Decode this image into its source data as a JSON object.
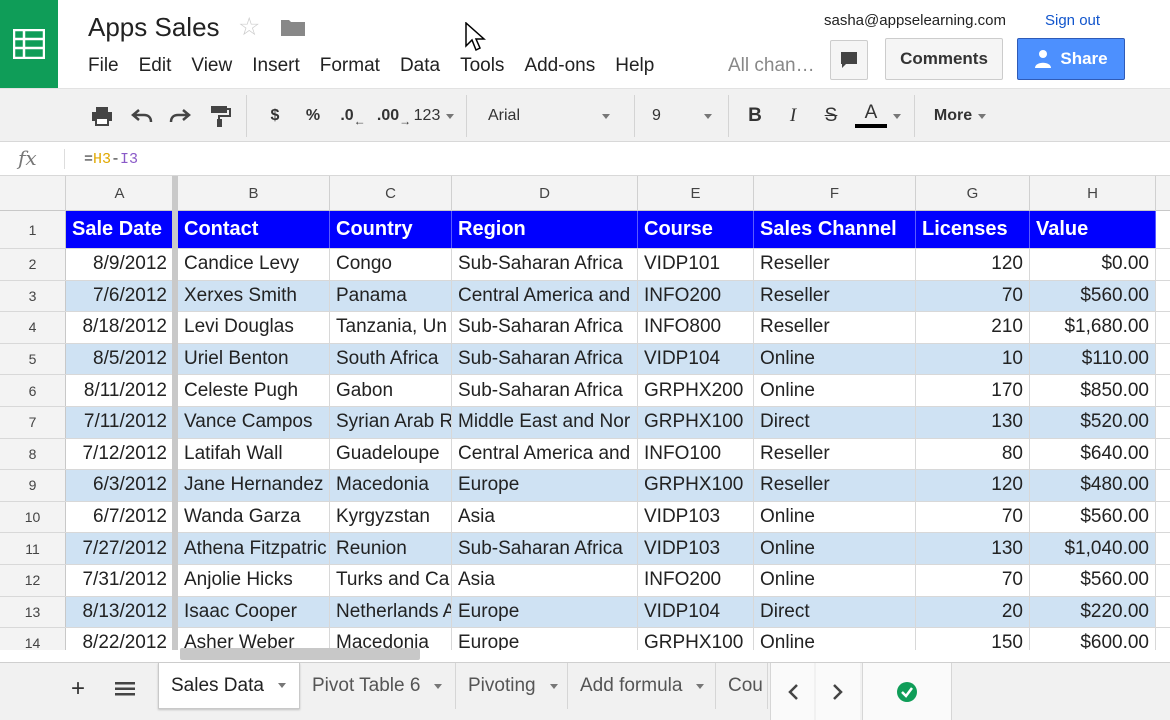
{
  "header": {
    "title": "Apps Sales",
    "star_icon": "star-icon",
    "folder_icon": "folder-icon",
    "user_email": "sasha@appselearning.com",
    "sign_out": "Sign out",
    "comments_label": "Comments",
    "share_label": "Share",
    "all_changes": "All chan…",
    "accent_color": "#0f9d58",
    "share_color": "#4d90fe"
  },
  "menu": [
    "File",
    "Edit",
    "View",
    "Insert",
    "Format",
    "Data",
    "Tools",
    "Add-ons",
    "Help"
  ],
  "toolbar": {
    "currency": "$",
    "percent": "%",
    "decrease_decimals": ".0",
    "increase_decimals": ".00",
    "more_formats": "123",
    "font": "Arial",
    "font_size": "9",
    "bold": "B",
    "italic": "I",
    "strike": "S",
    "text_color": "A",
    "more": "More"
  },
  "formula_bar": {
    "fx": "fx",
    "formula": "=H3-I3"
  },
  "grid": {
    "column_letters": [
      "A",
      "B",
      "C",
      "D",
      "E",
      "F",
      "G",
      "H"
    ],
    "header_fill": "#0000ff",
    "band_fill": "#cfe2f3",
    "rows": [
      {
        "num": "1",
        "cells": [
          "Sale Date",
          "Contact",
          "Country",
          "Region",
          "Course",
          "Sales Channel",
          "Licenses",
          "Value"
        ]
      },
      {
        "num": "2",
        "cells": [
          "8/9/2012",
          "Candice Levy",
          "Congo",
          "Sub-Saharan Africa",
          "VIDP101",
          "Reseller",
          "120",
          "$0.00"
        ]
      },
      {
        "num": "3",
        "cells": [
          "7/6/2012",
          "Xerxes Smith",
          "Panama",
          "Central America and",
          "INFO200",
          "Reseller",
          "70",
          "$560.00"
        ]
      },
      {
        "num": "4",
        "cells": [
          "8/18/2012",
          "Levi Douglas",
          "Tanzania, Un",
          "Sub-Saharan Africa",
          "INFO800",
          "Reseller",
          "210",
          "$1,680.00"
        ]
      },
      {
        "num": "5",
        "cells": [
          "8/5/2012",
          "Uriel Benton",
          "South Africa",
          "Sub-Saharan Africa",
          "VIDP104",
          "Online",
          "10",
          "$110.00"
        ]
      },
      {
        "num": "6",
        "cells": [
          "8/11/2012",
          "Celeste Pugh",
          "Gabon",
          "Sub-Saharan Africa",
          "GRPHX200",
          "Online",
          "170",
          "$850.00"
        ]
      },
      {
        "num": "7",
        "cells": [
          "7/11/2012",
          "Vance Campos",
          "Syrian Arab R",
          "Middle East and Nor",
          "GRPHX100",
          "Direct",
          "130",
          "$520.00"
        ]
      },
      {
        "num": "8",
        "cells": [
          "7/12/2012",
          "Latifah Wall",
          "Guadeloupe",
          "Central America and",
          "INFO100",
          "Reseller",
          "80",
          "$640.00"
        ]
      },
      {
        "num": "9",
        "cells": [
          "6/3/2012",
          "Jane Hernandez",
          "Macedonia",
          "Europe",
          "GRPHX100",
          "Reseller",
          "120",
          "$480.00"
        ]
      },
      {
        "num": "10",
        "cells": [
          "6/7/2012",
          "Wanda Garza",
          "Kyrgyzstan",
          "Asia",
          "VIDP103",
          "Online",
          "70",
          "$560.00"
        ]
      },
      {
        "num": "11",
        "cells": [
          "7/27/2012",
          "Athena Fitzpatric",
          "Reunion",
          "Sub-Saharan Africa",
          "VIDP103",
          "Online",
          "130",
          "$1,040.00"
        ]
      },
      {
        "num": "12",
        "cells": [
          "7/31/2012",
          "Anjolie Hicks",
          "Turks and Ca",
          "Asia",
          "INFO200",
          "Online",
          "70",
          "$560.00"
        ]
      },
      {
        "num": "13",
        "cells": [
          "8/13/2012",
          "Isaac Cooper",
          "Netherlands A",
          "Europe",
          "VIDP104",
          "Direct",
          "20",
          "$220.00"
        ]
      },
      {
        "num": "14",
        "cells": [
          "8/22/2012",
          "Asher Weber",
          "Macedonia",
          "Europe",
          "GRPHX100",
          "Online",
          "150",
          "$600.00"
        ]
      }
    ]
  },
  "sheets": {
    "add_sheet": "+",
    "tabs": [
      "Sales Data",
      "Pivot Table 6",
      "Pivoting",
      "Add formula",
      "Cou"
    ],
    "active": "Sales Data"
  }
}
